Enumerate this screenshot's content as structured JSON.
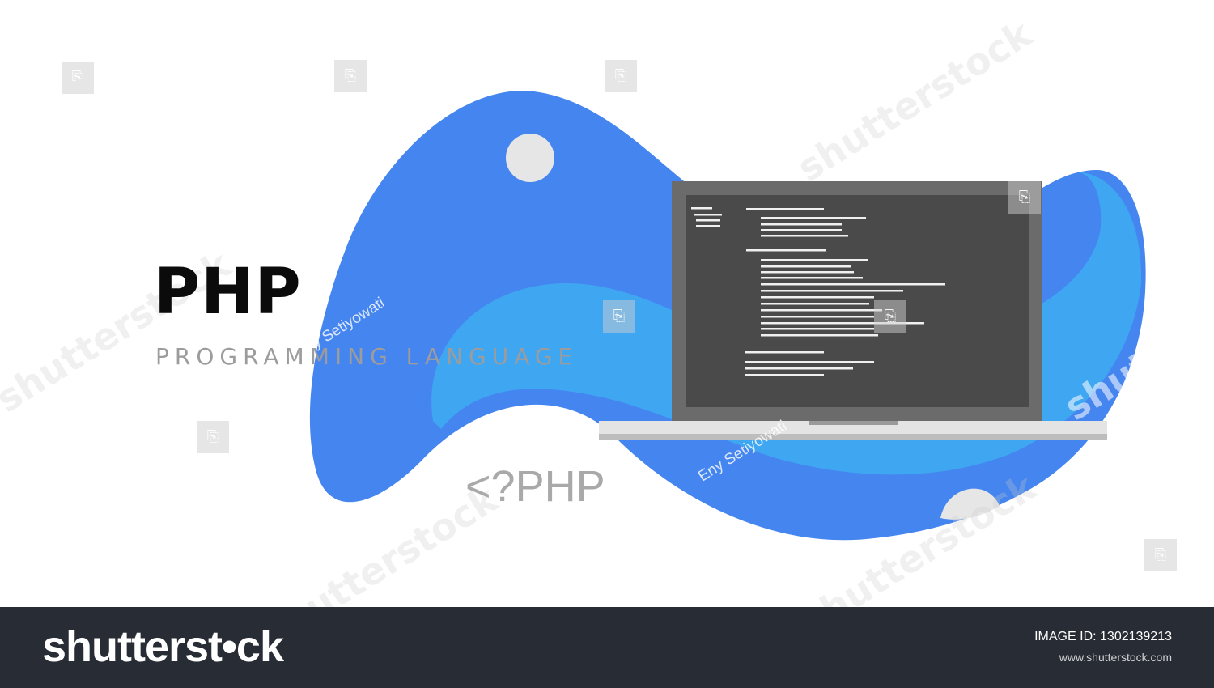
{
  "colors": {
    "blob_dark": "#4585f0",
    "blob_light": "#3fa6f2",
    "laptop_frame": "#6b6b6b",
    "screen": "#4a4a4a",
    "code_line": "#f0f0f0",
    "footer_bg": "#282c35"
  },
  "headline": {
    "title": "PHP",
    "subtitle": "PROGRAMMING LANGUAGE",
    "code_tag": "<?PHP"
  },
  "watermarks": {
    "author": "Eny Setiyowati",
    "logo": "shutterstock"
  },
  "footer": {
    "logo": "shutterst•ck",
    "image_id_label": "IMAGE ID:",
    "image_id": "1302139213",
    "url": "www.shutterstock.com"
  },
  "icons": {
    "laptop": "laptop-icon",
    "watermark": "shutterstock-square-icon"
  }
}
